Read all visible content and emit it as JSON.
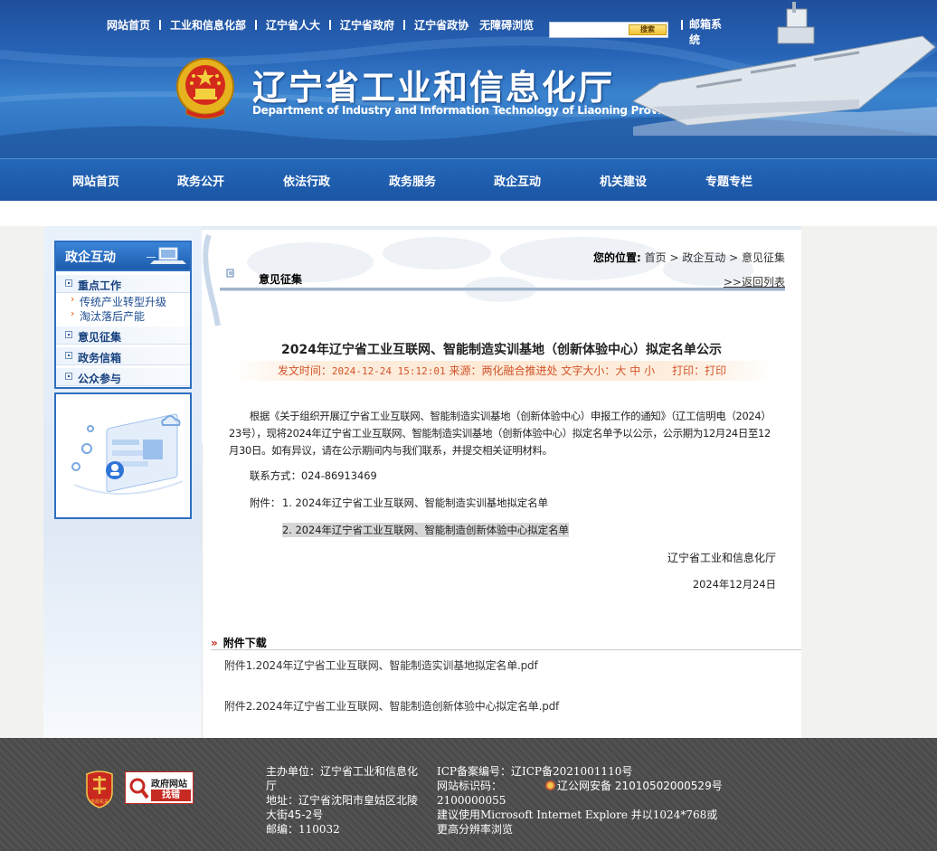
{
  "header": {
    "top_links": [
      "网站首页",
      "工业和信息化部",
      "辽宁省人大",
      "辽宁省政府",
      "辽宁省政协",
      "无障碍浏览"
    ],
    "search_button": "搜索",
    "mail_link": "邮箱系统",
    "title": "辽宁省工业和信息化厅",
    "subtitle": "Department of Industry and Information Technology of Liaoning Province"
  },
  "main_nav": [
    "网站首页",
    "政务公开",
    "依法行政",
    "政务服务",
    "政企互动",
    "机关建设",
    "专题专栏"
  ],
  "sidebar": {
    "heading": "政企互动",
    "items": [
      {
        "label": "重点工作"
      },
      {
        "label": "意见征集"
      },
      {
        "label": "政务信箱"
      },
      {
        "label": "公众参与"
      }
    ],
    "sub_items": [
      "传统产业转型升级",
      "淘汰落后产能"
    ]
  },
  "breadcrumb": {
    "label": "您的位置:",
    "path": "首页 > 政企互动 > 意见征集"
  },
  "section": {
    "title": "意见征集",
    "back_link": ">>返回列表"
  },
  "article": {
    "title": "2024年辽宁省工业互联网、智能制造实训基地（创新体验中心）拟定名单公示",
    "meta": {
      "time_label": "发文时间：",
      "time_value": "2024-12-24 15:12:01",
      "source_label": "来源：",
      "source_value": "两化融合推进处",
      "size_label": "文字大小：",
      "size_options": [
        "大",
        "中",
        "小"
      ],
      "print_label": "打印：",
      "print_value": "打印"
    },
    "body": "根据《关于组织开展辽宁省工业互联网、智能制造实训基地（创新体验中心）申报工作的通知》（辽工信明电（2024）23号），现将2024年辽宁省工业互联网、智能制造实训基地（创新体验中心）拟定名单予以公示，公示期为12月24日至12月30日。如有异议，请在公示期间内与我们联系，并提交相关证明材料。",
    "contact": "联系方式：024-86913469",
    "attach_label": "附件：",
    "attachment_1": "1. 2024年辽宁省工业互联网、智能制造实训基地拟定名单",
    "attachment_2": "2. 2024年辽宁省工业互联网、智能制造创新体验中心拟定名单",
    "signer": "辽宁省工业和信息化厅",
    "date": "2024年12月24日"
  },
  "downloads": {
    "heading": "附件下载",
    "files": [
      "附件1.2024年辽宁省工业互联网、智能制造实训基地拟定名单.pdf",
      "附件2.2024年辽宁省工业互联网、智能制造创新体验中心拟定名单.pdf"
    ]
  },
  "footer": {
    "badge_text": "党政机关",
    "find_error_top": "政府网站",
    "find_error_bottom": "找错",
    "sponsor": "主办单位：辽宁省工业和信息化厅",
    "address": "地址：辽宁省沈阳市皇姑区北陵大街45-2号",
    "postcode": "邮编：110032",
    "icp": "ICP备案编号：辽ICP备2021001110号",
    "site_id_label": "网站标识码：",
    "police": "辽公网安备 21010502000529号",
    "site_id": "2100000055",
    "browser_note": "建议使用Microsoft Internet Explore 并以1024*768或更高分辨率浏览"
  }
}
